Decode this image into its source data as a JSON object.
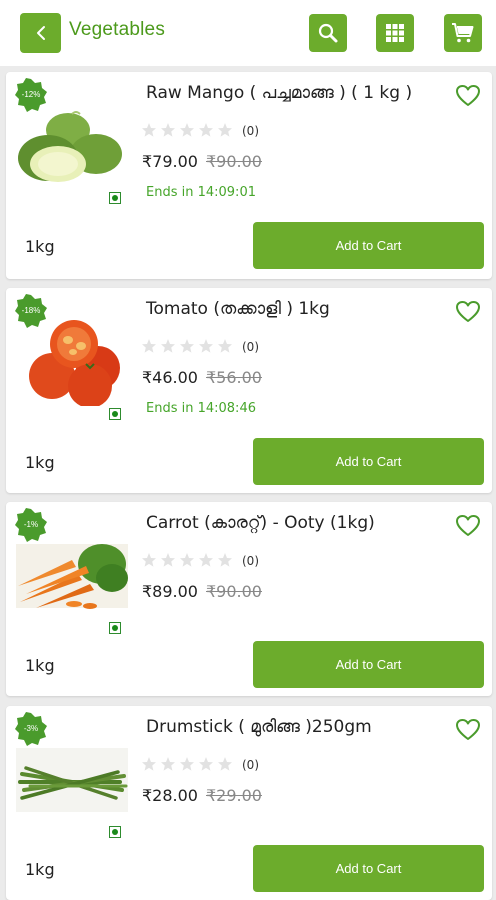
{
  "header": {
    "title": "Vegetables",
    "back_icon": "chevron-left-icon",
    "search_icon": "search-icon",
    "grid_icon": "grid-icon",
    "cart_icon": "cart-icon"
  },
  "colors": {
    "accent": "#6cac2c",
    "title_green": "#4c9a1c",
    "timer_green": "#46a52a"
  },
  "products": [
    {
      "discount": "-12%",
      "name": "Raw Mango ( പച്ചമാങ്ങ ) ( 1 kg )",
      "rating_count": "(0)",
      "price": "₹79.00",
      "old_price": "₹90.00",
      "timer": "Ends in 14:09:01",
      "unit": "1kg",
      "cart_label": "Add to Cart"
    },
    {
      "discount": "-18%",
      "name": "Tomato (തക്കാളി ) 1kg",
      "rating_count": "(0)",
      "price": "₹46.00",
      "old_price": "₹56.00",
      "timer": "Ends in 14:08:46",
      "unit": "1kg",
      "cart_label": "Add to Cart"
    },
    {
      "discount": "-1%",
      "name": "Carrot (കാരറ്റ്) - Ooty (1kg)",
      "rating_count": "(0)",
      "price": "₹89.00",
      "old_price": "₹90.00",
      "timer": "",
      "unit": "1kg",
      "cart_label": "Add to Cart"
    },
    {
      "discount": "-3%",
      "name": "Drumstick ( മുരിങ്ങ )250gm",
      "rating_count": "(0)",
      "price": "₹28.00",
      "old_price": "₹29.00",
      "timer": "",
      "unit": "1kg",
      "cart_label": "Add to Cart"
    }
  ]
}
